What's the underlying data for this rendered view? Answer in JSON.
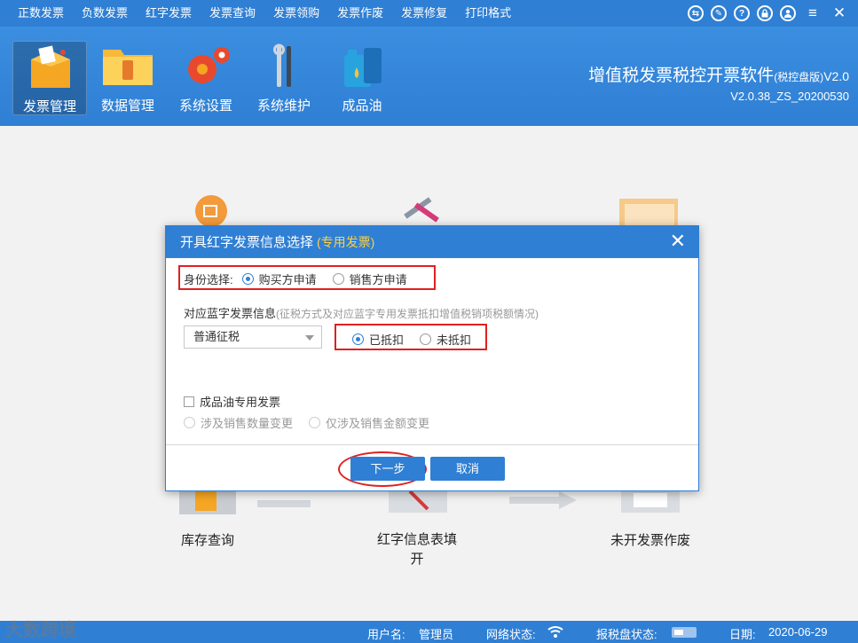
{
  "menu": [
    "正数发票",
    "负数发票",
    "红字发票",
    "发票查询",
    "发票领购",
    "发票作废",
    "发票修复",
    "打印格式"
  ],
  "window_tools": {
    "icons": [
      "switch-icon",
      "edit-icon",
      "help-icon",
      "lock-icon",
      "user-icon",
      "menu-icon",
      "close-icon"
    ],
    "labels": [
      "⇆",
      "✎",
      "?",
      "🔒",
      "👤",
      "≡",
      "✕"
    ]
  },
  "toolbar": {
    "items": [
      {
        "label": "发票管理",
        "icon": "invoice-box-icon",
        "active": true
      },
      {
        "label": "数据管理",
        "icon": "folder-icon",
        "active": false
      },
      {
        "label": "系统设置",
        "icon": "gears-icon",
        "active": false
      },
      {
        "label": "系统维护",
        "icon": "tools-icon",
        "active": false
      },
      {
        "label": "成品油",
        "icon": "oil-can-icon",
        "active": false
      }
    ],
    "app_title": "增值税发票税控开票软件",
    "app_title_small": "(税控盘版)",
    "app_title_version_suffix": "V2.0",
    "version": "V2.0.38_ZS_20200530"
  },
  "background": {
    "captions": [
      "库存查询",
      "红字信息表填开",
      "未开发票作废"
    ]
  },
  "dialog": {
    "title": "开具红字发票信息选择",
    "subtitle": "(专用发票)",
    "close": "✕",
    "identity_label": "身份选择:",
    "identity_options": [
      "购买方申请",
      "销售方申请"
    ],
    "identity_selected": "购买方申请",
    "blue_info_label": "对应蓝字发票信息",
    "blue_info_hint": "(征税方式及对应蓝字专用发票抵扣增值税销项税额情况)",
    "tax_mode_value": "普通征税",
    "deduct_options": [
      "已抵扣",
      "未抵扣"
    ],
    "deduct_selected": "已抵扣",
    "oil_checkbox_label": "成品油专用发票",
    "oil_options": [
      "涉及销售数量变更",
      "仅涉及销售金额变更"
    ],
    "next_button": "下一步",
    "cancel_button": "取消"
  },
  "statusbar": {
    "user_label": "用户名:",
    "user_value": "管理员",
    "network_label": "网络状态:",
    "disk_label": "报税盘状态:",
    "date_label": "日期:",
    "date_value": "2020-06-29"
  },
  "watermark": "大数跨境",
  "colors": {
    "primary": "#2f7fd4",
    "highlight_red": "#e02020",
    "subtitle_yellow": "#ffd23f"
  }
}
